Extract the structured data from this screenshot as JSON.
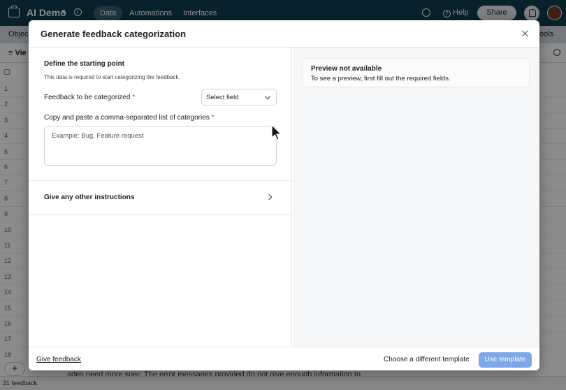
{
  "app": {
    "base_name": "AI Demo",
    "nav_tabs": [
      "Data",
      "Automations",
      "Interfaces"
    ],
    "help_label": "Help",
    "share_label": "Share",
    "objects_label": "Object",
    "tools_label": "ools",
    "views_label": "Vie"
  },
  "grid": {
    "row_numbers": [
      "1",
      "2",
      "3",
      "4",
      "5",
      "6",
      "7",
      "8",
      "9",
      "10",
      "11",
      "12",
      "13",
      "14",
      "15",
      "16",
      "17",
      "18"
    ],
    "partial_cells": [
      "ades need more spec...",
      "The error messages provided do not give enough information to..."
    ],
    "record_count": "31 feedback"
  },
  "modal": {
    "title": "Generate feedback categorization",
    "left": {
      "section_title": "Define the starting point",
      "section_subtitle": "This data is required to start categorizing the feedback.",
      "feedback_label": "Feedback to be categorized",
      "feedback_select_value": "Select field",
      "categories_label": "Copy and paste a comma-separated list of categories",
      "categories_placeholder": "Example: Bug, Feature request",
      "required_marker": "*",
      "instructions_label": "Give any other instructions"
    },
    "right": {
      "preview_title": "Preview not available",
      "preview_text": "To see a preview, first fill out the required fields."
    },
    "footer": {
      "give_feedback": "Give feedback",
      "different_template": "Choose a different template",
      "use_template": "Use template"
    }
  },
  "colors": {
    "topbar": "#0f3d4f",
    "primary_button_disabled": "#7da7e6",
    "required": "#d33c3c"
  }
}
